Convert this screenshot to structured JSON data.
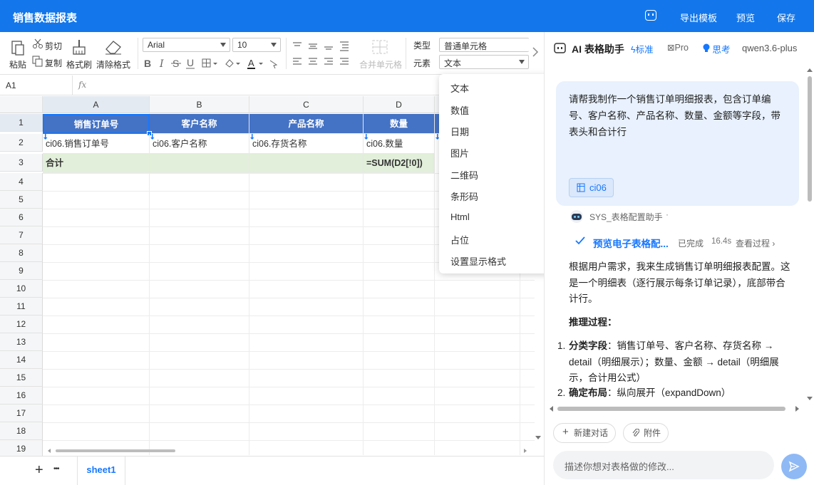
{
  "app_title": "销售数据报表",
  "topbar": {
    "export_template": "导出模板",
    "preview": "预览",
    "save": "保存"
  },
  "ribbon": {
    "paste": "粘贴",
    "cut": "剪切",
    "copy": "复制",
    "format_painter": "格式刷",
    "clear_format": "清除格式",
    "font": "Arial",
    "font_size": "10",
    "merge": "合并单元格",
    "type_label": "类型",
    "type_value": "普通单元格",
    "elem_label": "元素",
    "elem_value": "文本"
  },
  "formula_bar": {
    "cell_ref": "A1",
    "fx": "fx"
  },
  "grid": {
    "columns": [
      "A",
      "B",
      "C",
      "D"
    ],
    "rows": [
      "1",
      "2",
      "3",
      "4",
      "5",
      "6",
      "7",
      "8",
      "9",
      "10",
      "11",
      "12",
      "13",
      "14",
      "15",
      "16",
      "17",
      "18",
      "19"
    ],
    "header_row": [
      "销售订单号",
      "客户名称",
      "产品名称",
      "数量"
    ],
    "detail_row": [
      "ci06.销售订单号",
      "ci06.客户名称",
      "ci06.存货名称",
      "ci06.数量"
    ],
    "total_label": "合计",
    "total_formula": "=SUM(D2[!0])"
  },
  "sheets": {
    "add": "+",
    "more": "•••",
    "active": "sheet1"
  },
  "dropdown": {
    "options": [
      "文本",
      "数值",
      "日期",
      "图片",
      "二维码",
      "条形码",
      "Html",
      "占位",
      "设置显示格式"
    ]
  },
  "panel": {
    "title": "AI 表格助手",
    "mode_standard": "标准",
    "mode_pro": "Pro",
    "mode_think": "思考",
    "model": "qwen3.6-plus",
    "user_message": "请帮我制作一个销售订单明细报表，包含订单编号、客户名称、产品名称、数量、金额等字段，带表头和合计行",
    "user_chip": "ci06",
    "bot_name": "SYS_表格配置助手",
    "bot_caret": "·",
    "task_title": "预览电子表格配...",
    "task_status": "已完成",
    "task_time": "16.4s",
    "task_view": "查看过程",
    "answer_intro": "根据用户需求，我来生成销售订单明细报表配置。这是一个明细表（逐行展示每条订单记录），底部带合计行。",
    "reasoning_heading": "推理过程：",
    "reasoning": [
      {
        "num": "1.",
        "bold": "分类字段",
        "text": "：销售订单号、客户名称、存货名称 → detail（明细展示）；数量、金额 → detail（明细展示，合计用公式）"
      },
      {
        "num": "2.",
        "bold": "确定布局",
        "text": "：纵向展开（expandDown）"
      }
    ],
    "new_chat": "新建对话",
    "attachment": "附件",
    "input_placeholder": "描述你想对表格做的修改..."
  },
  "colors": {
    "brand": "#1377eb",
    "header_fill": "#4472c4",
    "total_fill": "#e2efda",
    "accent": "#1677ff"
  }
}
